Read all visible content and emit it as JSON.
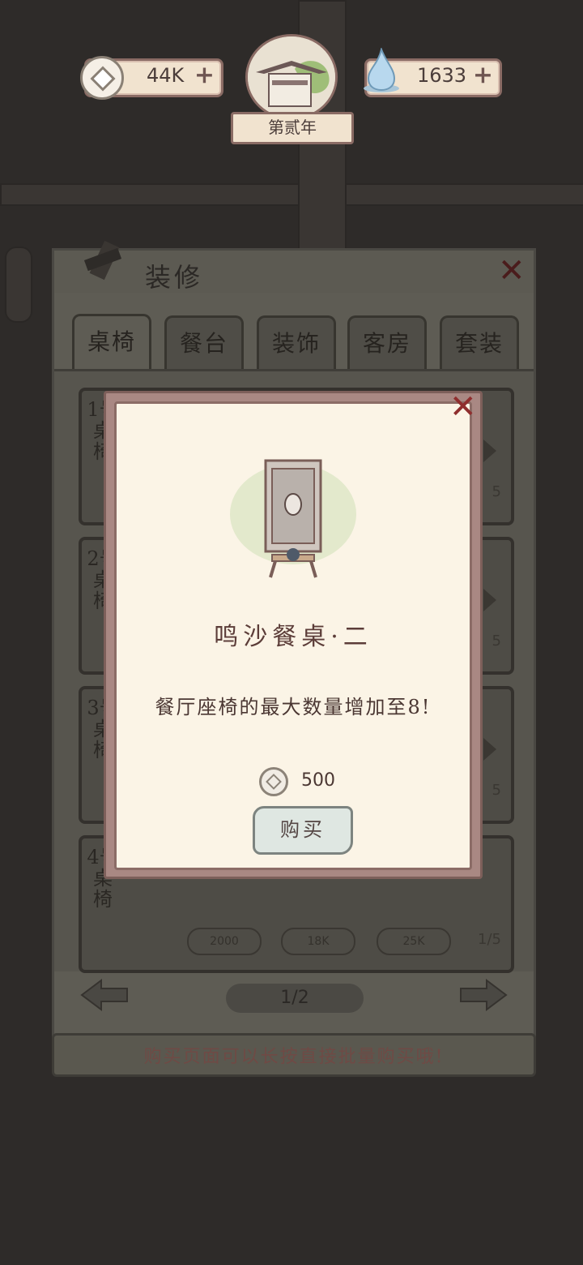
{
  "topbar": {
    "coins": "44K",
    "spirit": "1633",
    "year": "第贰年"
  },
  "panel": {
    "title": "装修",
    "tabs": [
      "桌椅",
      "餐台",
      "装饰",
      "客房",
      "套装"
    ],
    "rows": [
      {
        "label": "1号桌椅",
        "count": "5"
      },
      {
        "label": "2号桌椅",
        "count": "5"
      },
      {
        "label": "3号桌椅",
        "count": "5"
      },
      {
        "label": "4号桌椅",
        "count": "1/5",
        "prices": [
          "2000",
          "18K",
          "25K"
        ]
      }
    ],
    "pager": "1/2",
    "tip": "购买页面可以长按直接批量购买哦!"
  },
  "modal": {
    "item_name": "鸣沙餐桌·二",
    "description": "餐厅座椅的最大数量增加至8!",
    "cost": "500",
    "buy_label": "购买"
  },
  "colors": {
    "accent_red": "#8f2e2e",
    "paper": "#fbf4e6",
    "frame": "#a98883"
  }
}
